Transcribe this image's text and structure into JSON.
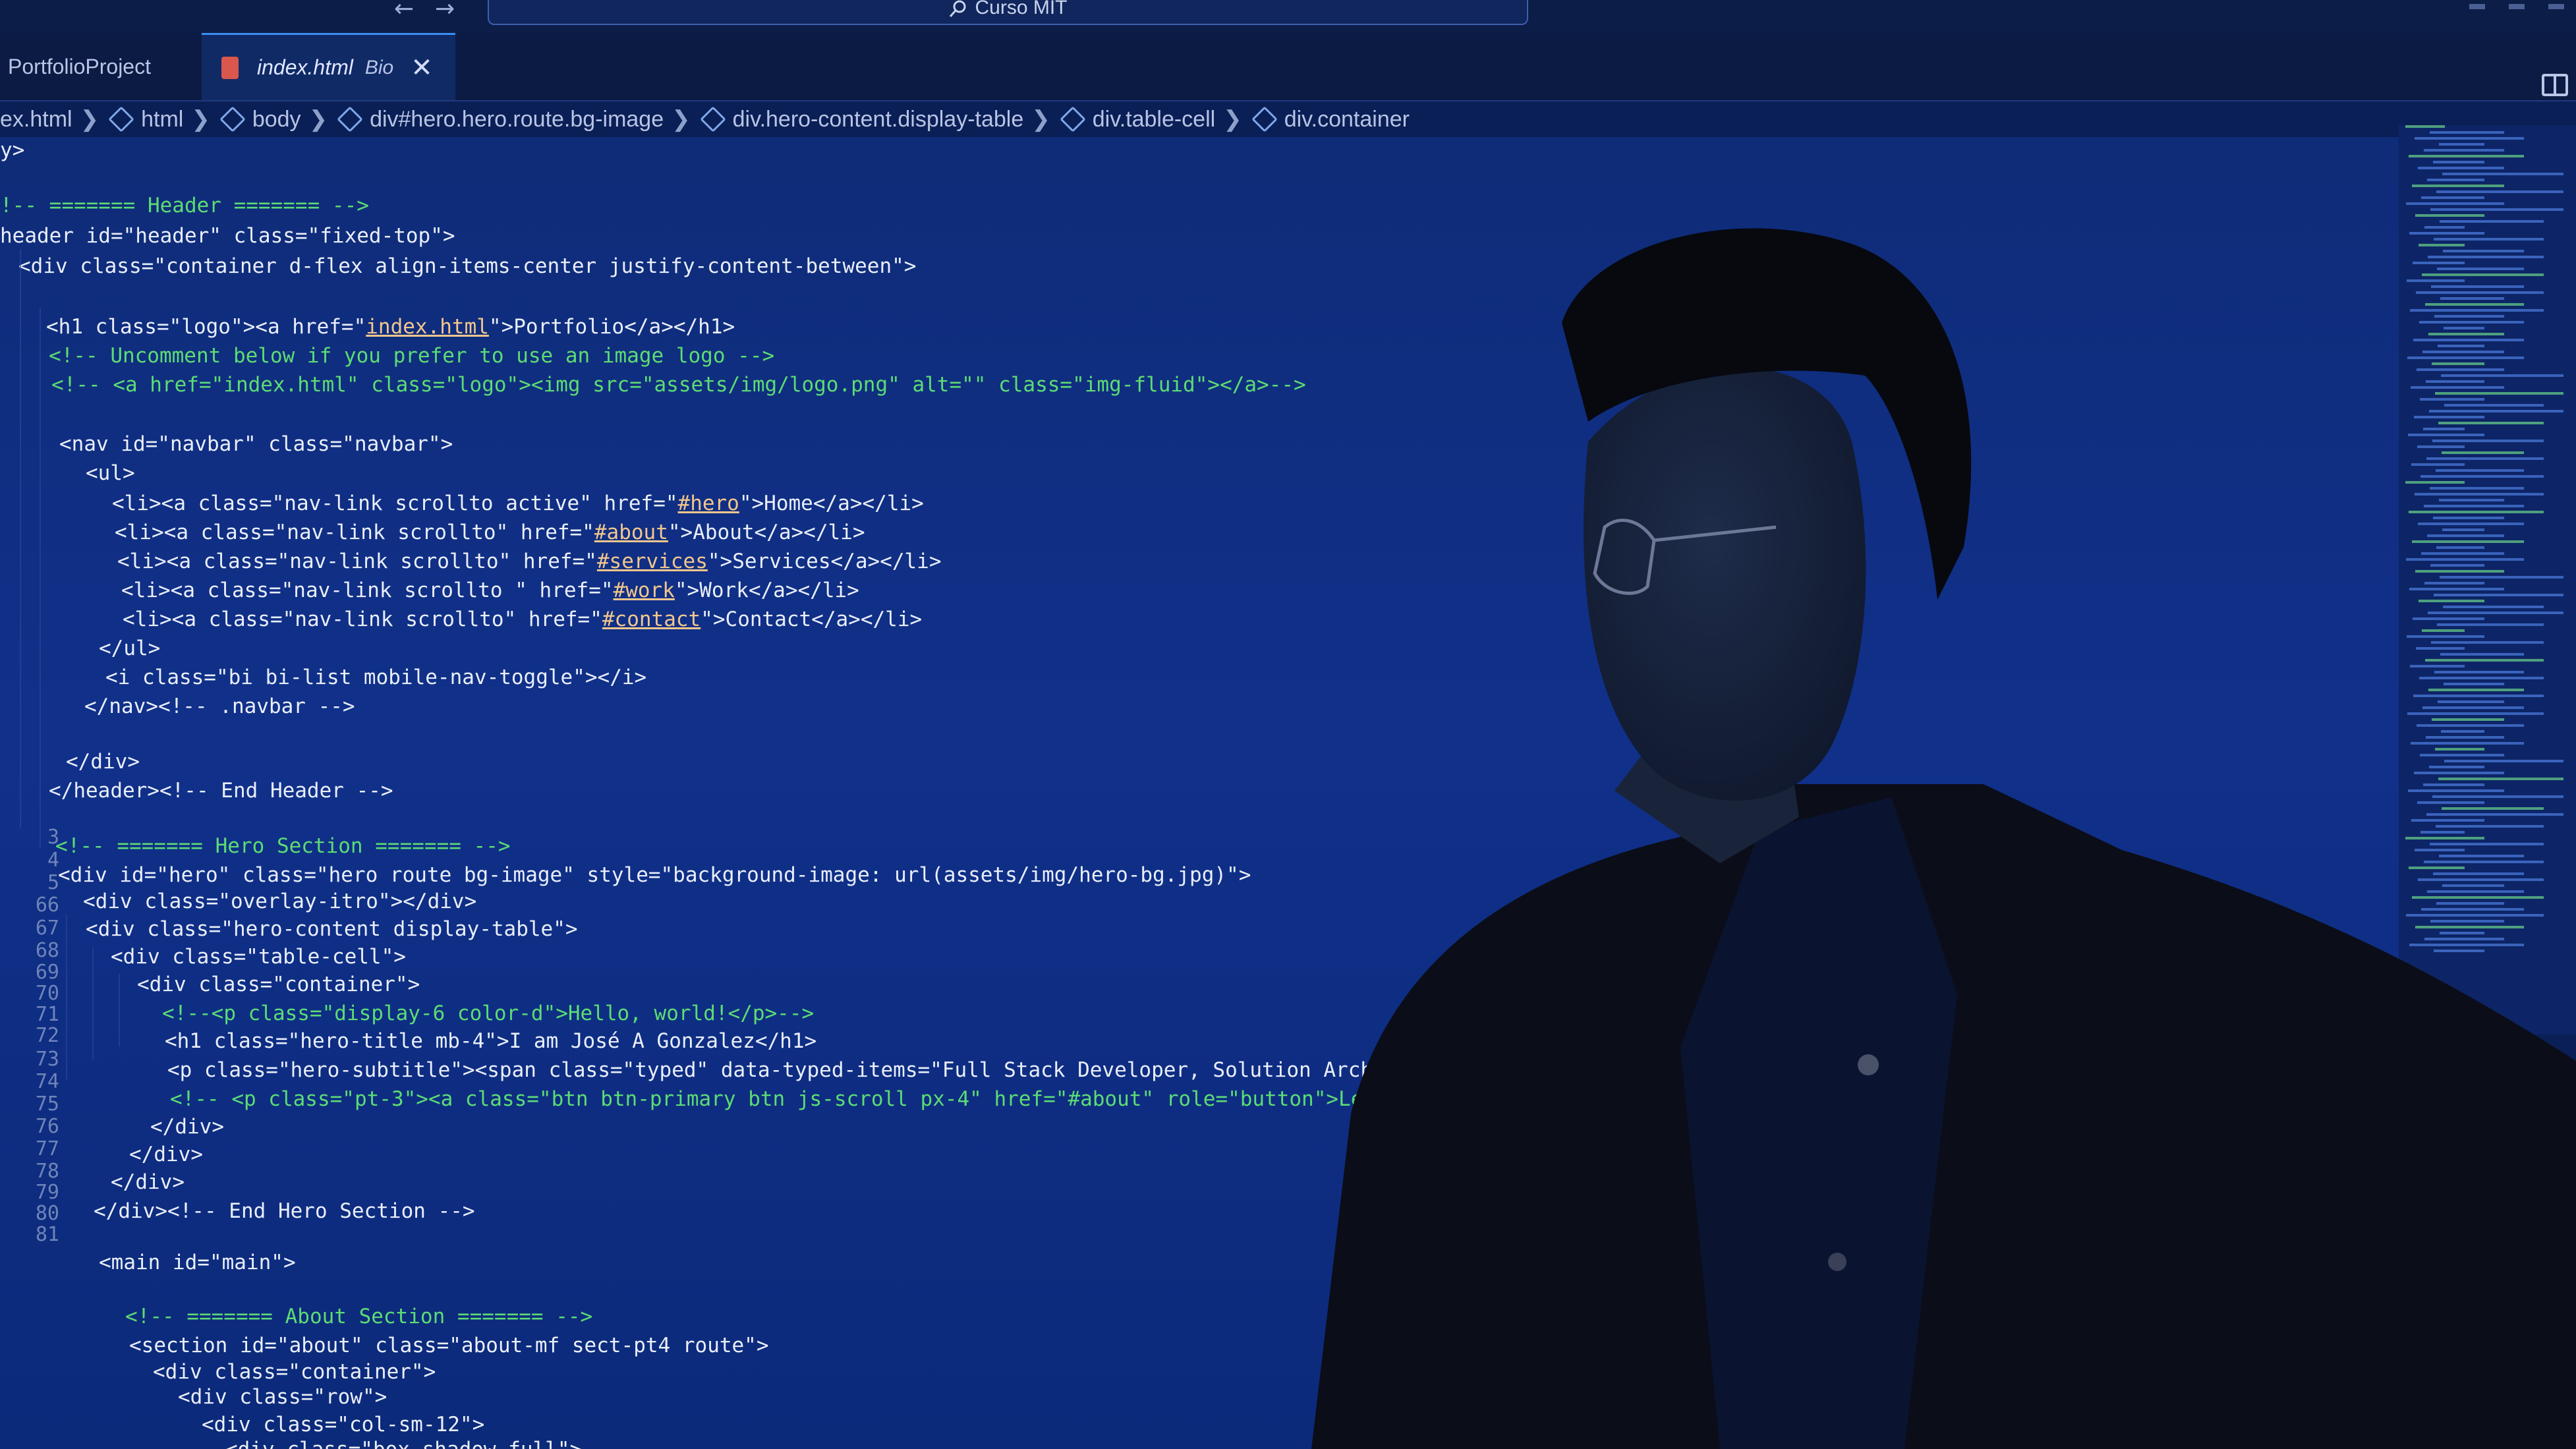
{
  "title_bar": {
    "back_arrow": "←",
    "forward_arrow": "→",
    "command_center": "Curso MIT",
    "search_icon": "magnifier-icon"
  },
  "tabs": [
    {
      "label": "PortfolioProject"
    },
    {
      "label": "index.html",
      "suffix": "Bio",
      "close": "✕"
    }
  ],
  "breadcrumb": [
    "ex.html",
    "html",
    "body",
    "div#hero.hero.route.bg-image",
    "div.hero-content.display-table",
    "div.table-cell",
    "div.container"
  ],
  "gutter_numbers": [
    "3",
    "4",
    "5",
    "66",
    "67",
    "68",
    "69",
    "70",
    "71",
    "72",
    "73",
    "74",
    "75",
    "76",
    "77",
    "78",
    "79",
    "80",
    "81"
  ],
  "code_lines": [
    {
      "text": "y>"
    },
    {
      "text": "!-- ======= Header ======= -->",
      "kind": "comment"
    },
    {
      "text": "header id=\"header\" class=\"fixed-top\">"
    },
    {
      "text": "<div class=\"container d-flex align-items-center justify-content-between\">"
    },
    {
      "text": "<h1 class=\"logo\"><a href=\"",
      "link": "index.html",
      "after": "\">Portfolio</a></h1>"
    },
    {
      "text": "<!-- Uncomment below if you prefer to use an image logo -->",
      "kind": "comment"
    },
    {
      "text": "<!-- <a href=\"index.html\" class=\"logo\"><img src=\"assets/img/logo.png\" alt=\"\" class=\"img-fluid\"></a>-->",
      "kind": "comment"
    },
    {
      "text": "<nav id=\"navbar\" class=\"navbar\">"
    },
    {
      "text": "<ul>"
    },
    {
      "text": "<li><a class=\"nav-link scrollto active\" href=\"",
      "link": "#hero",
      "after": "\">Home</a></li>"
    },
    {
      "text": "<li><a class=\"nav-link scrollto\" href=\"",
      "link": "#about",
      "after": "\">About</a></li>"
    },
    {
      "text": "<li><a class=\"nav-link scrollto\" href=\"",
      "link": "#services",
      "after": "\">Services</a></li>"
    },
    {
      "text": "<li><a class=\"nav-link scrollto \" href=\"",
      "link": "#work",
      "after": "\">Work</a></li>"
    },
    {
      "text": "<li><a class=\"nav-link scrollto\" href=\"",
      "link": "#contact",
      "after": "\">Contact</a></li>"
    },
    {
      "text": "</ul>"
    },
    {
      "text": "<i class=\"bi bi-list mobile-nav-toggle\"></i>"
    },
    {
      "text": "</nav><!-- .navbar -->"
    },
    {
      "text": "</div>"
    },
    {
      "text": "</header><!-- End Header -->"
    },
    {
      "text": "<!-- ======= Hero Section ======= -->",
      "kind": "comment"
    },
    {
      "text": "<div id=\"hero\" class=\"hero route bg-image\" style=\"background-image: url(assets/img/hero-bg.jpg)\">"
    },
    {
      "text": "<div class=\"overlay-itro\"></div>"
    },
    {
      "text": "<div class=\"hero-content display-table\">"
    },
    {
      "text": "<div class=\"table-cell\">"
    },
    {
      "text": "<div class=\"container\">"
    },
    {
      "text": "<!--<p class=\"display-6 color-d\">Hello, world!</p>-->",
      "kind": "comment"
    },
    {
      "text": "<h1 class=\"hero-title mb-4\">I am José A Gonzalez</h1>"
    },
    {
      "text": "<p class=\"hero-subtitle\"><span class=\"typed\" data-typed-items=\"Full Stack Developer, Solution Architect, DevSecOp"
    },
    {
      "text": "<!-- <p class=\"pt-3\"><a class=\"btn btn-primary btn js-scroll px-4\" href=\"#about\" role=\"button\">Learn More</a></p",
      "kind": "comment"
    },
    {
      "text": "</div>"
    },
    {
      "text": "</div>"
    },
    {
      "text": "</div>"
    },
    {
      "text": "</div><!-- End Hero Section -->"
    },
    {
      "text": "<main id=\"main\">"
    },
    {
      "text": "<!-- ======= About Section ======= -->",
      "kind": "comment"
    },
    {
      "text": "<section id=\"about\" class=\"about-mf sect-pt4 route\">"
    },
    {
      "text": "<div class=\"container\">"
    },
    {
      "text": "<div class=\"row\">"
    },
    {
      "text": "<div class=\"col-sm-12\">"
    },
    {
      "text": "<div class=\"box-shadow-full\">"
    }
  ],
  "colors": {
    "editor_bg": "#10308a",
    "comment": "#5cdc74",
    "text": "#e9eef9",
    "link": "#f2c68c"
  }
}
